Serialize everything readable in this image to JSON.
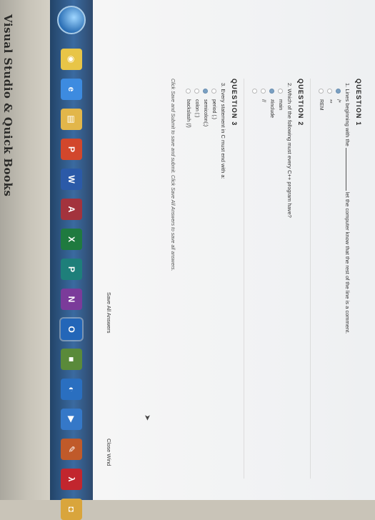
{
  "caption": "Visual Studio & Quick Books",
  "questions": [
    {
      "header": "QUESTION 1",
      "text_before": "1. Lines beginning with the",
      "text_after": "let the computer know that the rest of the line is a comment.",
      "options": [
        "/*",
        "**",
        "REM"
      ],
      "selected": 0
    },
    {
      "header": "QUESTION 2",
      "text": "2. Which of the following must every C++ program have?",
      "options": [
        "main",
        "#include",
        "//",
        ""
      ],
      "selected": 1
    },
    {
      "header": "QUESTION 3",
      "text": "3. Every statement in C must end with a:",
      "options": [
        "period (.)",
        "semicolon(;)",
        "colon (:)",
        "backslash (/)"
      ],
      "selected": 1
    }
  ],
  "instructions": "Click Save and Submit to save and submit. Click Save All Answers to save all answers.",
  "buttons": {
    "save_all": "Save All Answers",
    "close_window": "Close Wind"
  },
  "taskbar": {
    "icons": [
      {
        "name": "chrome-icon",
        "color": "#e8c547",
        "glyph": "◉"
      },
      {
        "name": "ie-icon",
        "color": "#3d8be0",
        "glyph": "e"
      },
      {
        "name": "file-explorer-icon",
        "color": "#e2b64a",
        "glyph": "▤"
      },
      {
        "name": "powerpoint-icon",
        "color": "#d2472c",
        "glyph": "P"
      },
      {
        "name": "word-icon",
        "color": "#2b5aa8",
        "glyph": "W"
      },
      {
        "name": "access-icon",
        "color": "#a3333d",
        "glyph": "A"
      },
      {
        "name": "excel-icon",
        "color": "#1f7a3f",
        "glyph": "X"
      },
      {
        "name": "publisher-icon",
        "color": "#1e7f7a",
        "glyph": "P"
      },
      {
        "name": "onenote-icon",
        "color": "#7b3b9a",
        "glyph": "N"
      },
      {
        "name": "outlook-icon",
        "color": "#2366b8",
        "glyph": "O"
      },
      {
        "name": "minecraft-icon",
        "color": "#5a8a3a",
        "glyph": "■"
      },
      {
        "name": "ps-icon",
        "color": "#2a6fc0",
        "glyph": "◐"
      },
      {
        "name": "media-icon",
        "color": "#3578c8",
        "glyph": "▶"
      },
      {
        "name": "paint-icon",
        "color": "#c05a2a",
        "glyph": "✎"
      },
      {
        "name": "acrobat-icon",
        "color": "#c2262e",
        "glyph": "λ"
      },
      {
        "name": "explorer-folder-icon",
        "color": "#d9a53c",
        "glyph": "◘"
      }
    ]
  }
}
